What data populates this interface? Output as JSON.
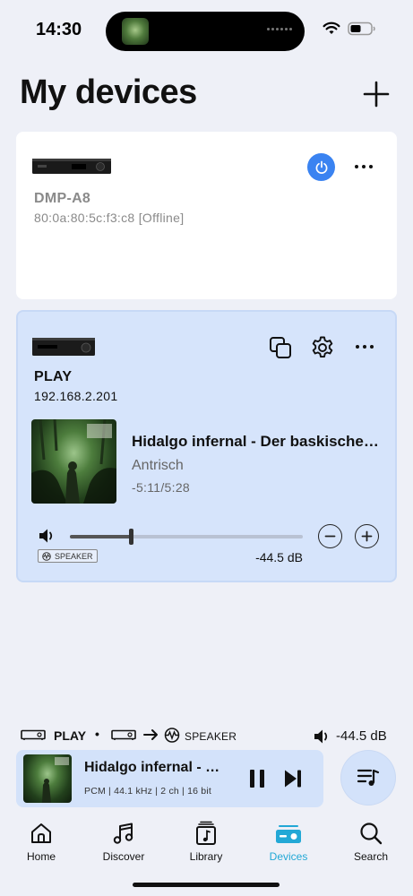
{
  "status": {
    "time": "14:30"
  },
  "header": {
    "title": "My devices"
  },
  "devices": [
    {
      "name": "DMP-A8",
      "address": "80:0a:80:5c:f3:c8 [Offline]"
    },
    {
      "name": "PLAY",
      "address": "192.168.2.201",
      "now_playing": {
        "title": "Hidalgo infernal - Der baskischen Hexenverfolgung",
        "artist": "Antrisch",
        "time": "-5:11/5:28"
      },
      "volume": {
        "level": 0.26,
        "db": "-44.5 dB",
        "output": "SPEAKER"
      }
    }
  ],
  "route": {
    "device": "PLAY",
    "separator": "•",
    "output": "SPEAKER",
    "volume": "-44.5 dB"
  },
  "mini_player": {
    "title": "Hidalgo infernal - Der baskischen Hexenverfolgung",
    "format": "PCM | 44.1 kHz | 2 ch | 16 bit"
  },
  "tabs": [
    {
      "label": "Home",
      "icon": "home-icon"
    },
    {
      "label": "Discover",
      "icon": "music-note-icon"
    },
    {
      "label": "Library",
      "icon": "library-icon"
    },
    {
      "label": "Devices",
      "icon": "devices-icon",
      "active": true
    },
    {
      "label": "Search",
      "icon": "search-icon"
    }
  ],
  "colors": {
    "accent": "#3a83f1",
    "active_tab": "#22a8d6",
    "active_card": "#d6e4fb"
  }
}
